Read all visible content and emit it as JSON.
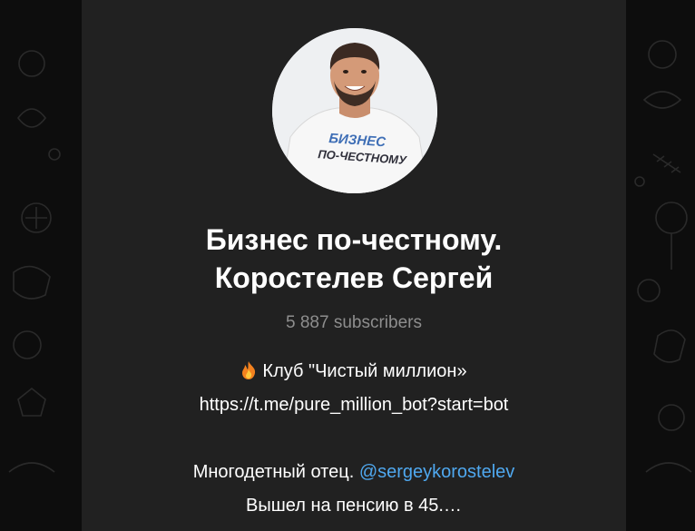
{
  "channel": {
    "title_line1": "Бизнес по-честному.",
    "title_line2": "Коростелев Сергей",
    "subscribers": "5 887 subscribers",
    "avatar": {
      "shirt_text_line1": "БИЗНЕС",
      "shirt_text_line2": "ПО-ЧЕСТНОМУ"
    },
    "description": {
      "club_icon": "fire-icon",
      "club_text": "Клуб \"Чистый миллион»",
      "bot_link": "https://t.me/pure_million_bot?start=bot",
      "bio_text": "Многодетный отец.",
      "mention": "@sergeykorostelev",
      "pension_text": "Вышел на пенсию в 45.…"
    }
  },
  "colors": {
    "background": "#0e0e0e",
    "card": "#212121",
    "title": "#ffffff",
    "muted": "#8e8e8e",
    "link": "#4fa8ef"
  }
}
